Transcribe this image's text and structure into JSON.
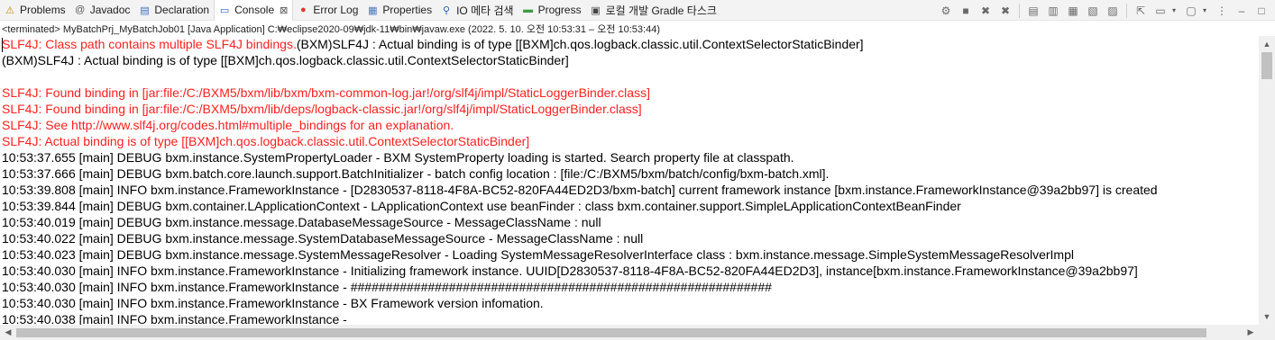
{
  "tabs": [
    {
      "label": "Problems",
      "icon": "problems-icon",
      "glyph": "⚠",
      "color": "#c58a00"
    },
    {
      "label": "Javadoc",
      "icon": "javadoc-icon",
      "glyph": "@",
      "color": "#5a5a5a"
    },
    {
      "label": "Declaration",
      "icon": "declaration-icon",
      "glyph": "▤",
      "color": "#3a6fb7"
    },
    {
      "label": "Console",
      "icon": "console-icon",
      "glyph": "▭",
      "color": "#2b62b5",
      "active": true,
      "close": "⊠"
    },
    {
      "label": "Error Log",
      "icon": "error-log-icon",
      "glyph": "●",
      "color": "#d33b2c"
    },
    {
      "label": "Properties",
      "icon": "properties-icon",
      "glyph": "▦",
      "color": "#4a78b8"
    },
    {
      "label": "IO 메타 검색",
      "icon": "io-meta-search-icon",
      "glyph": "⚲",
      "color": "#2b62b5"
    },
    {
      "label": "Progress",
      "icon": "progress-icon",
      "glyph": "▬",
      "color": "#3f9a3f"
    },
    {
      "label": "로컬 개발 Gradle 타스크",
      "icon": "gradle-task-icon",
      "glyph": "▣",
      "color": "#444"
    }
  ],
  "toolbar": [
    {
      "name": "pin-console-icon",
      "glyph": "⚙"
    },
    {
      "name": "terminate-icon",
      "glyph": "■"
    },
    {
      "name": "remove-launch-icon",
      "glyph": "✖"
    },
    {
      "name": "remove-all-terminated-icon",
      "glyph": "✖"
    },
    {
      "sep": true
    },
    {
      "name": "clear-console-icon",
      "glyph": "▤"
    },
    {
      "name": "scroll-lock-icon",
      "glyph": "▥"
    },
    {
      "name": "word-wrap-icon",
      "glyph": "▦"
    },
    {
      "name": "show-on-stdout-icon",
      "glyph": "▧"
    },
    {
      "name": "show-on-stderr-icon",
      "glyph": "▨"
    },
    {
      "sep": true
    },
    {
      "name": "pin-icon",
      "glyph": "⇱"
    },
    {
      "name": "display-console-icon",
      "glyph": "▭",
      "drop": true
    },
    {
      "name": "open-console-icon",
      "glyph": "▢",
      "drop": true
    },
    {
      "name": "view-menu-icon",
      "glyph": "⋮"
    },
    {
      "name": "minimize-icon",
      "glyph": "–"
    },
    {
      "name": "maximize-icon",
      "glyph": "□"
    }
  ],
  "status_line": "<terminated> MyBatchPrj_MyBatchJob01 [Java Application] C:₩eclipse2020-09₩jdk-11₩bin₩javaw.exe  (2022. 5. 10. 오전 10:53:31 – 오전 10:53:44)",
  "console_lines": [
    {
      "type": "mixed",
      "err": "SLF4J: Class path contains multiple SLF4J bindings.",
      "out": "(BXM)SLF4J : Actual binding is of type [[BXM]ch.qos.logback.classic.util.ContextSelectorStaticBinder]"
    },
    {
      "type": "out",
      "text": "(BXM)SLF4J : Actual binding is of type [[BXM]ch.qos.logback.classic.util.ContextSelectorStaticBinder]"
    },
    {
      "type": "blank",
      "text": ""
    },
    {
      "type": "err",
      "text": "SLF4J: Found binding in [jar:file:/C:/BXM5/bxm/lib/bxm/bxm-common-log.jar!/org/slf4j/impl/StaticLoggerBinder.class]"
    },
    {
      "type": "err",
      "text": "SLF4J: Found binding in [jar:file:/C:/BXM5/bxm/lib/deps/logback-classic.jar!/org/slf4j/impl/StaticLoggerBinder.class]"
    },
    {
      "type": "err",
      "text": "SLF4J: See http://www.slf4j.org/codes.html#multiple_bindings for an explanation."
    },
    {
      "type": "err",
      "text": "SLF4J: Actual binding is of type [[BXM]ch.qos.logback.classic.util.ContextSelectorStaticBinder]"
    },
    {
      "type": "out",
      "text": "10:53:37.655 [main] DEBUG bxm.instance.SystemPropertyLoader - BXM SystemProperty loading is started. Search property file at classpath."
    },
    {
      "type": "out",
      "text": "10:53:37.666 [main] DEBUG bxm.batch.core.launch.support.BatchInitializer - batch config location : [file:/C:/BXM5/bxm/batch/config/bxm-batch.xml]."
    },
    {
      "type": "out",
      "text": "10:53:39.808 [main] INFO bxm.instance.FrameworkInstance - [D2830537-8118-4F8A-BC52-820FA44ED2D3/bxm-batch] current framework instance [bxm.instance.FrameworkInstance@39a2bb97] is created"
    },
    {
      "type": "out",
      "text": "10:53:39.844 [main] DEBUG bxm.container.LApplicationContext - LApplicationContext use beanFinder : class bxm.container.support.SimpleLApplicationContextBeanFinder"
    },
    {
      "type": "out",
      "text": "10:53:40.019 [main] DEBUG bxm.instance.message.DatabaseMessageSource - MessageClassName : null"
    },
    {
      "type": "out",
      "text": "10:53:40.022 [main] DEBUG bxm.instance.message.SystemDatabaseMessageSource - MessageClassName : null"
    },
    {
      "type": "out",
      "text": "10:53:40.023 [main] DEBUG bxm.instance.message.SystemMessageResolver - Loading SystemMessageResolverInterface class : bxm.instance.message.SimpleSystemMessageResolverImpl"
    },
    {
      "type": "out",
      "text": "10:53:40.030 [main] INFO bxm.instance.FrameworkInstance - Initializing framework instance. UUID[D2830537-8118-4F8A-BC52-820FA44ED2D3], instance[bxm.instance.FrameworkInstance@39a2bb97]"
    },
    {
      "type": "out",
      "text": "10:53:40.030 [main] INFO bxm.instance.FrameworkInstance - ############################################################"
    },
    {
      "type": "out",
      "text": "10:53:40.030 [main] INFO bxm.instance.FrameworkInstance - BX Framework version infomation."
    },
    {
      "type": "out",
      "text": "10:53:40.038 [main] INFO bxm.instance.FrameworkInstance -"
    }
  ],
  "scroll": {
    "up": "▲",
    "down": "▼",
    "left": "◀",
    "right": "▶"
  }
}
